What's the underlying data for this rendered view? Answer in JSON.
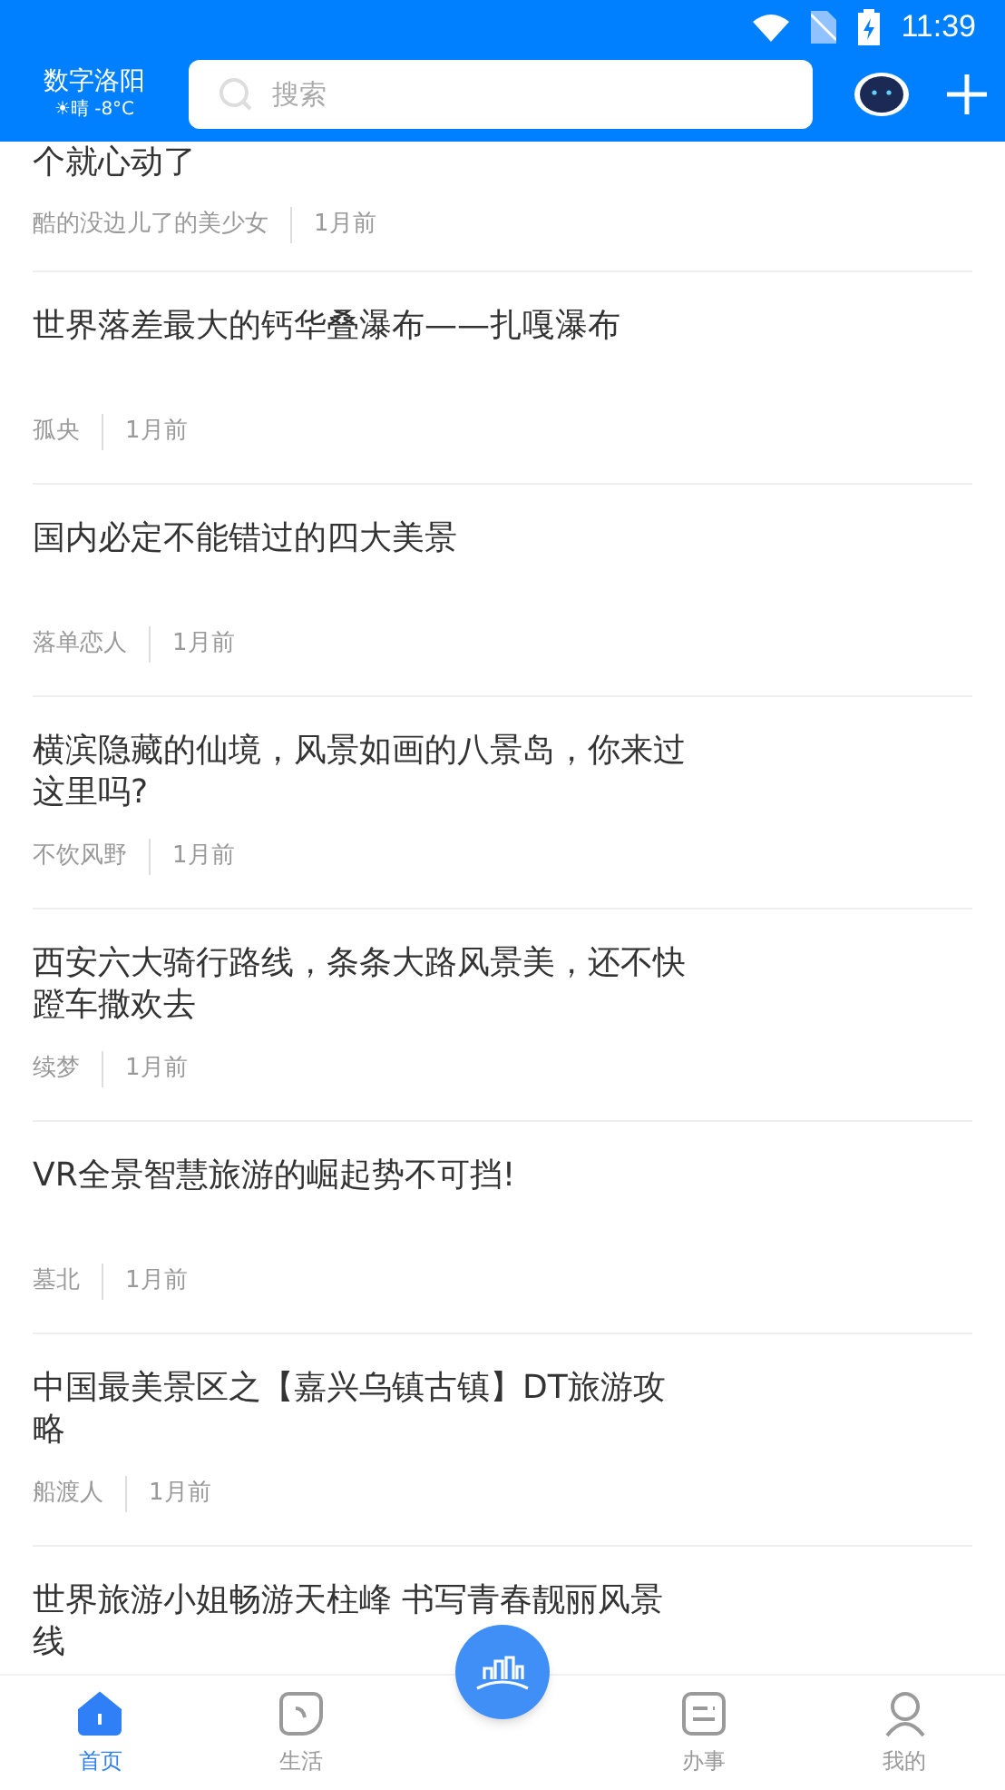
{
  "status_bar": {
    "time": "11:39"
  },
  "header": {
    "city": "数字洛阳",
    "weather": "☀晴 -8°C",
    "search": {
      "placeholder": "搜索"
    }
  },
  "articles": [
    {
      "title": "个就心动了",
      "author": "酷的没边儿了的美少女",
      "time": "1月前"
    },
    {
      "title": "世界落差最大的钙华叠瀑布——扎嘎瀑布",
      "author": "孤央",
      "time": "1月前"
    },
    {
      "title": "国内必定不能错过的四大美景",
      "author": "落单恋人",
      "time": "1月前"
    },
    {
      "title": "横滨隐藏的仙境，风景如画的八景岛，你来过这里吗?",
      "author": "不饮风野",
      "time": "1月前"
    },
    {
      "title": "西安六大骑行路线，条条大路风景美，还不快蹬车撒欢去",
      "author": "续梦",
      "time": "1月前"
    },
    {
      "title": "VR全景智慧旅游的崛起势不可挡!",
      "author": "墓北",
      "time": "1月前"
    },
    {
      "title": "中国最美景区之【嘉兴乌镇古镇】DT旅游攻略",
      "author": "船渡人",
      "time": "1月前"
    },
    {
      "title": "世界旅游小姐畅游天柱峰 书写青春靓丽风景线"
    }
  ],
  "tabs": [
    {
      "label": "首页",
      "kind": "home",
      "selected": true
    },
    {
      "label": "生活",
      "kind": "life",
      "selected": false
    },
    {
      "kind": "center",
      "selected": false
    },
    {
      "label": "办事",
      "kind": "tasks",
      "selected": false
    },
    {
      "label": "我的",
      "kind": "me",
      "selected": false
    }
  ]
}
